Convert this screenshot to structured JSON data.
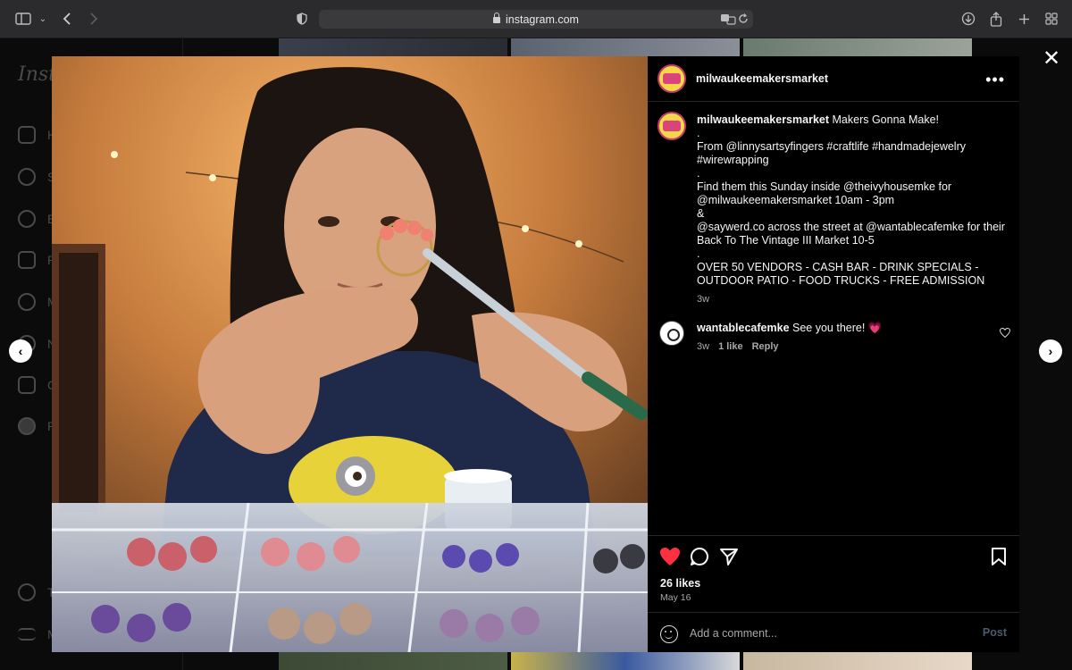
{
  "browser": {
    "url": "instagram.com",
    "icons": [
      "sidebar-icon",
      "chevron-down-icon",
      "back-icon",
      "forward-icon",
      "shield-icon",
      "translate-icon",
      "reload-icon",
      "download-icon",
      "share-icon",
      "new-tab-icon",
      "tab-overview-icon"
    ]
  },
  "background": {
    "logo_text": "Insta",
    "nav_letters": [
      "H",
      "S",
      "E",
      "R",
      "M",
      "N",
      "C",
      "P",
      "T",
      "M"
    ]
  },
  "post": {
    "username": "milwaukeemakersmarket",
    "caption_lines": [
      "Makers Gonna Make!",
      ".",
      "From @linnysartsyfingers #craftlife #handmadejewelry",
      "#wirewrapping",
      ".",
      "Find them this Sunday inside @theivyhousemke for",
      "@milwaukeemakersmarket 10am - 3pm",
      "&",
      "@saywerd.co across the street at @wantablecafemke for their",
      "Back To The Vintage III Market 10-5",
      ".",
      "OVER 50 VENDORS - CASH BAR - DRINK SPECIALS -",
      "OUTDOOR PATIO - FOOD TRUCKS - FREE ADMISSION"
    ],
    "caption_age": "3w",
    "likes": "26 likes",
    "date": "May 16",
    "colors": {
      "like_red": "#ff3040",
      "post_button": "#4a5a70"
    }
  },
  "comments": [
    {
      "username": "wantablecafemke",
      "text": "See you there! 💗",
      "age": "3w",
      "likes": "1 like",
      "reply": "Reply"
    }
  ],
  "comment_box": {
    "placeholder": "Add a comment...",
    "post_label": "Post"
  }
}
